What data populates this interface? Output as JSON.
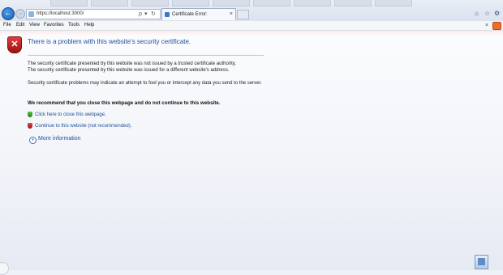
{
  "browser": {
    "address": {
      "url": "https://localhost:3000/",
      "search_glyph": "ρ",
      "dropdown_glyph": "▾",
      "refresh_glyph": "↻",
      "close_glyph": "×"
    },
    "active_tab": {
      "label": "Certificate Error: Navigation...",
      "close_glyph": "×"
    },
    "window_controls": {
      "home": "⌂",
      "favorites": "☆",
      "settings": "⚙"
    }
  },
  "menubar": {
    "items": [
      "File",
      "Edit",
      "View",
      "Favorites",
      "Tools",
      "Help"
    ],
    "close_glyph": "×"
  },
  "error_page": {
    "title": "There is a problem with this website's security certificate.",
    "paragraph_1_line_1": "The security certificate presented by this website was not issued by a trusted certificate authority.",
    "paragraph_1_line_2": "The security certificate presented by this website was issued for a different website's address.",
    "paragraph_2": "Security certificate problems may indicate an attempt to fool you or intercept any data you send to the server.",
    "recommendation": "We recommend that you close this webpage and do not continue to this website.",
    "close_link": "Click here to close this webpage.",
    "continue_link": "Continue to this website (not recommended).",
    "more_info": "More information"
  },
  "icons": {
    "shield": "shield-x-icon",
    "green_shield": "green-shield-icon",
    "red_shield": "red-shield-icon",
    "more_info": "expand-circle-icon"
  }
}
